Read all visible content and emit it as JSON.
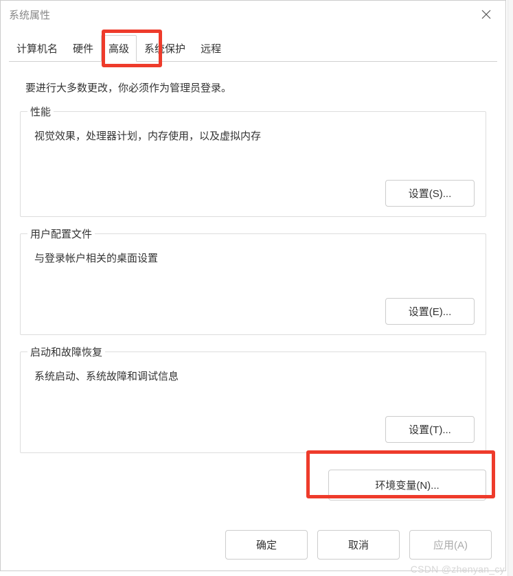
{
  "window": {
    "title": "系统属性"
  },
  "tabs": {
    "computer_name": "计算机名",
    "hardware": "硬件",
    "advanced": "高级",
    "system_protection": "系统保护",
    "remote": "远程"
  },
  "content": {
    "admin_note": "要进行大多数更改，你必须作为管理员登录。",
    "performance": {
      "title": "性能",
      "desc": "视觉效果，处理器计划，内存使用，以及虚拟内存",
      "button": "设置(S)..."
    },
    "user_profile": {
      "title": "用户配置文件",
      "desc": "与登录帐户相关的桌面设置",
      "button": "设置(E)..."
    },
    "startup": {
      "title": "启动和故障恢复",
      "desc": "系统启动、系统故障和调试信息",
      "button": "设置(T)..."
    },
    "env_button": "环境变量(N)..."
  },
  "footer": {
    "ok": "确定",
    "cancel": "取消",
    "apply": "应用(A)"
  },
  "watermark": "CSDN @zhenyan_cy"
}
